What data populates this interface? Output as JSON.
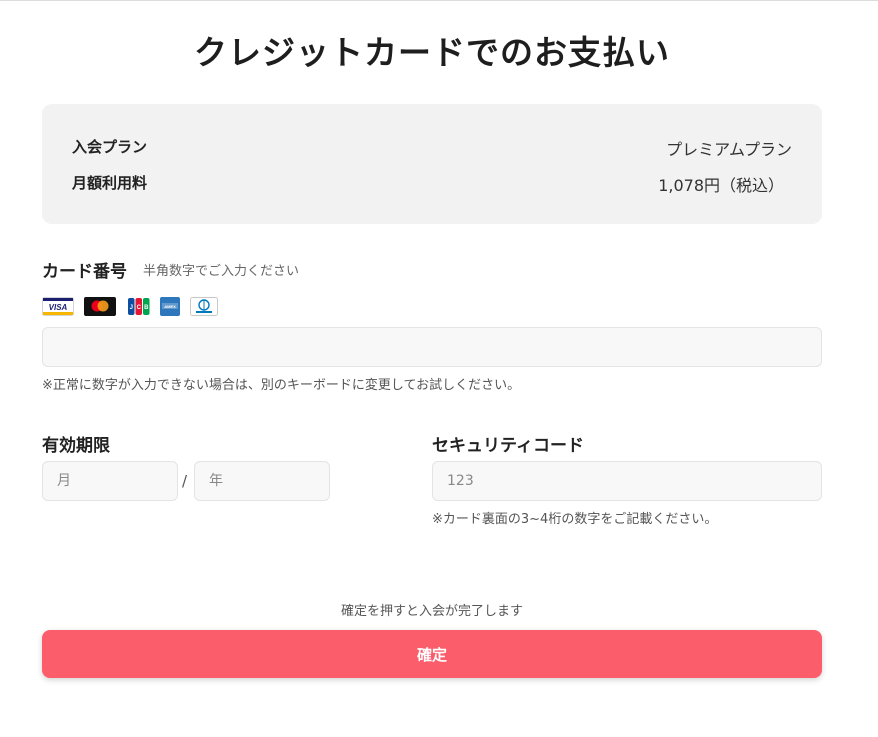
{
  "page": {
    "title": "クレジットカードでのお支払い"
  },
  "plan": {
    "rows": [
      {
        "key": "入会プラン",
        "value": "プレミアムプラン"
      },
      {
        "key": "月額利用料",
        "value": "1,078円（税込）"
      }
    ]
  },
  "card": {
    "label": "カード番号",
    "hint": "半角数字でご入力ください",
    "brands": [
      "VISA",
      "Mastercard",
      "JCB",
      "American Express",
      "Diners Club"
    ],
    "brand_icons": [
      "visa-icon",
      "mastercard-icon",
      "jcb-icon",
      "amex-icon",
      "diners-club-icon"
    ],
    "value": "",
    "placeholder": "",
    "note": "※正常に数字が入力できない場合は、別のキーボードに変更してお試しください。"
  },
  "expiry": {
    "label": "有効期限",
    "month_placeholder": "月",
    "year_placeholder": "年",
    "separator": "/"
  },
  "security": {
    "label": "セキュリティコード",
    "placeholder": "123",
    "note": "※カード裏面の3~4桁の数字をご記載ください。"
  },
  "submit": {
    "note": "確定を押すと入会が完了します",
    "button_label": "確定"
  },
  "colors": {
    "accent": "#fb5d6b",
    "panel_bg": "#f2f2f2",
    "input_bg": "#f8f8f8"
  }
}
